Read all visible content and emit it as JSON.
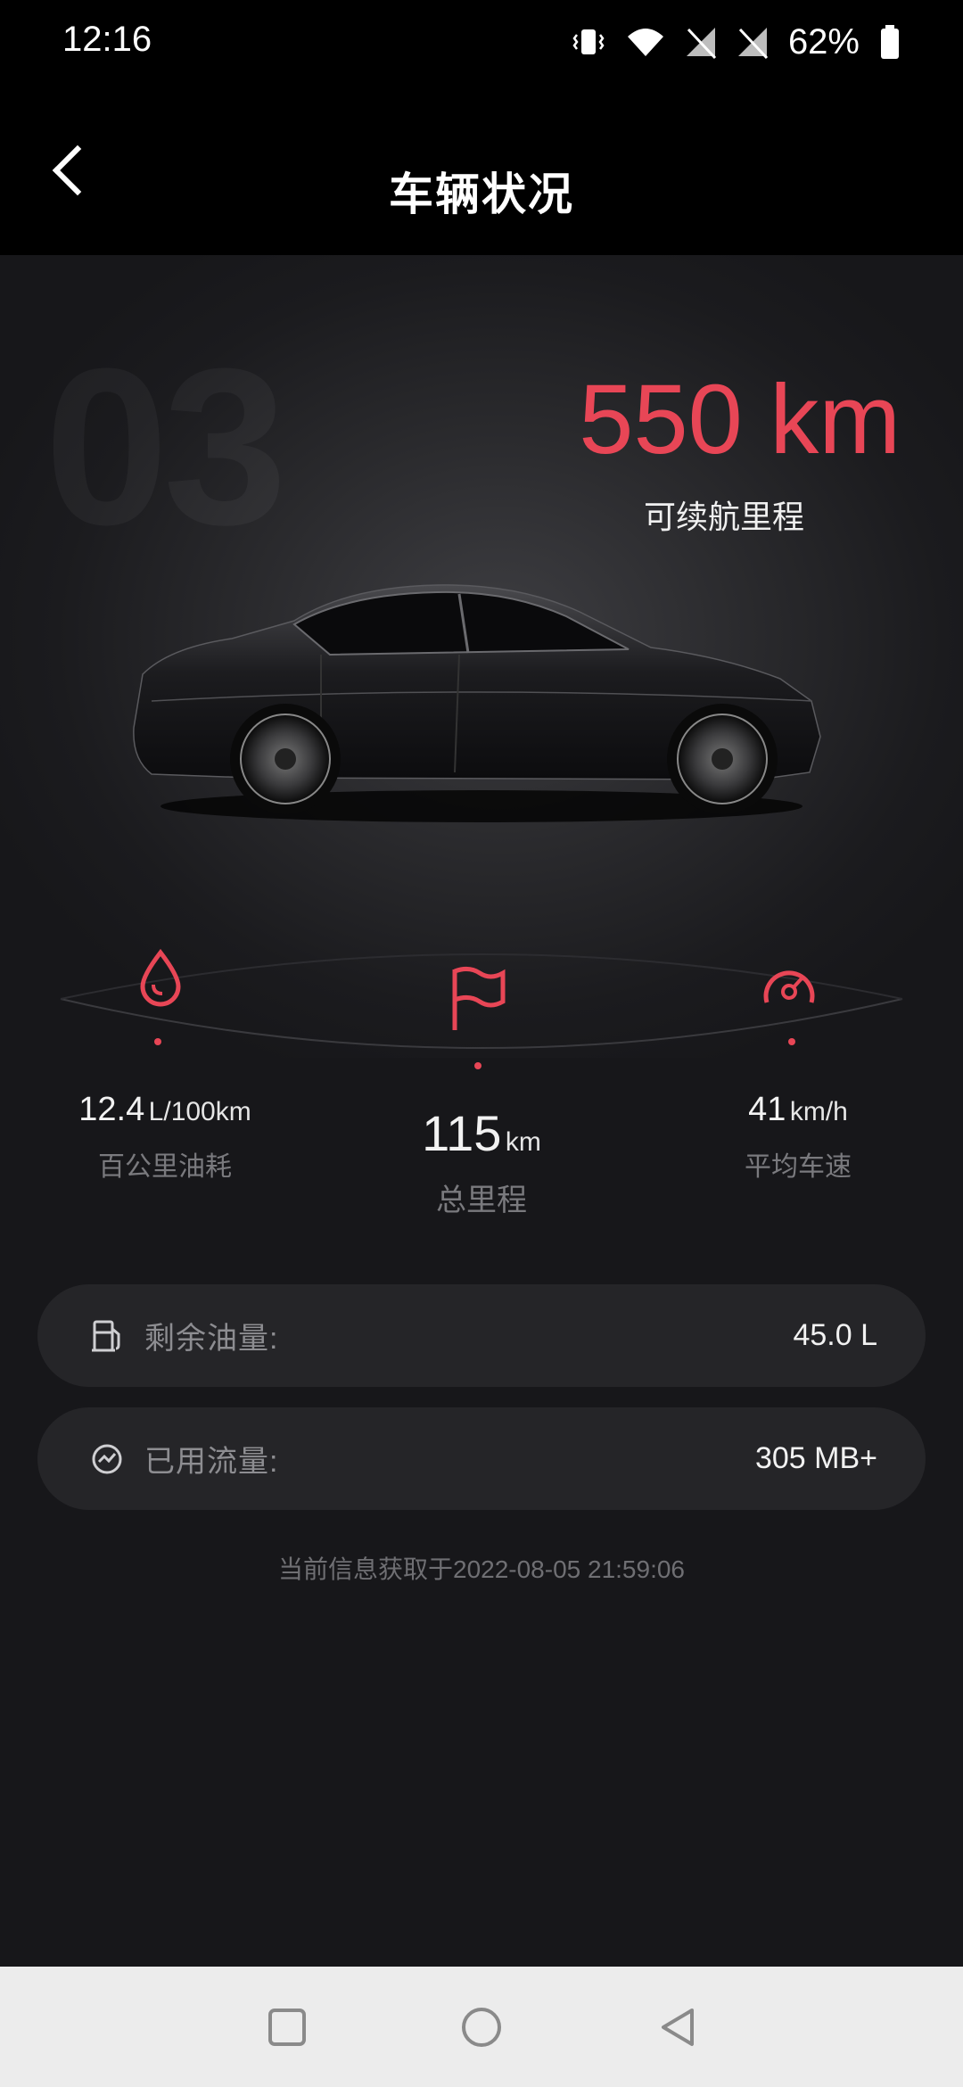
{
  "status_bar": {
    "time": "12:16",
    "battery": "62%"
  },
  "header": {
    "title": "车辆状况"
  },
  "hero": {
    "model_badge": "03",
    "range_value": "550 km",
    "range_label": "可续航里程"
  },
  "stats": [
    {
      "value": "12.4",
      "unit": "L/100km",
      "label": "百公里油耗",
      "icon": "droplet-icon"
    },
    {
      "value": "115",
      "unit": "km",
      "label": "总里程",
      "icon": "flag-icon"
    },
    {
      "value": "41",
      "unit": "km/h",
      "label": "平均车速",
      "icon": "speedometer-icon"
    }
  ],
  "info": {
    "fuel": {
      "label": "剩余油量:",
      "value": "45.0 L",
      "icon": "fuel-pump-icon"
    },
    "data": {
      "label": "已用流量:",
      "value": "305 MB+",
      "icon": "data-usage-icon"
    }
  },
  "update_time": "当前信息获取于2022-08-05 21:59:06",
  "colors": {
    "accent": "#e84656",
    "background": "#17171a",
    "card": "#252528"
  }
}
